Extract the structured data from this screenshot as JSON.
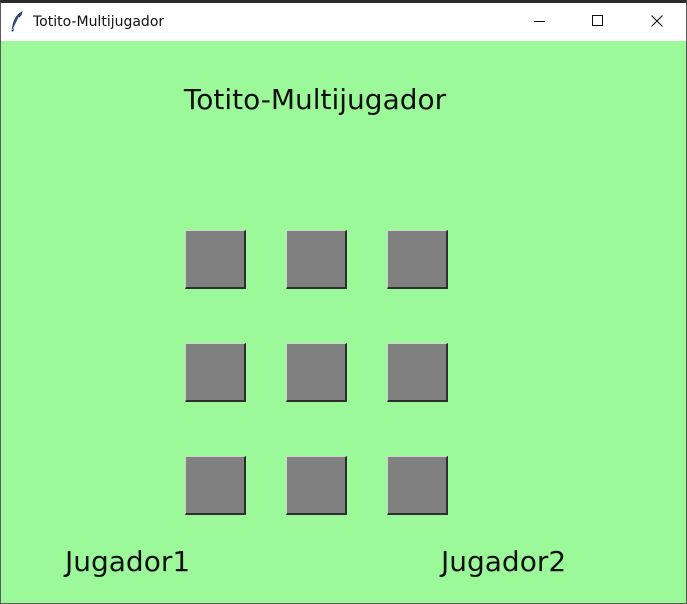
{
  "window": {
    "title": "Totito-Multijugador",
    "app_icon": "feather-icon",
    "controls": {
      "minimize_icon": "minimize-icon",
      "maximize_icon": "maximize-icon",
      "close_icon": "close-icon"
    }
  },
  "colors": {
    "background": "#9cf99a",
    "cell": "#808080",
    "text": "#111111"
  },
  "game": {
    "heading": "Totito-Multijugador",
    "board": {
      "rows": 3,
      "columns": 3,
      "cells": [
        "",
        "",
        "",
        "",
        "",
        "",
        "",
        "",
        ""
      ]
    },
    "players": {
      "player1": "Jugador1",
      "player2": "Jugador2"
    }
  }
}
